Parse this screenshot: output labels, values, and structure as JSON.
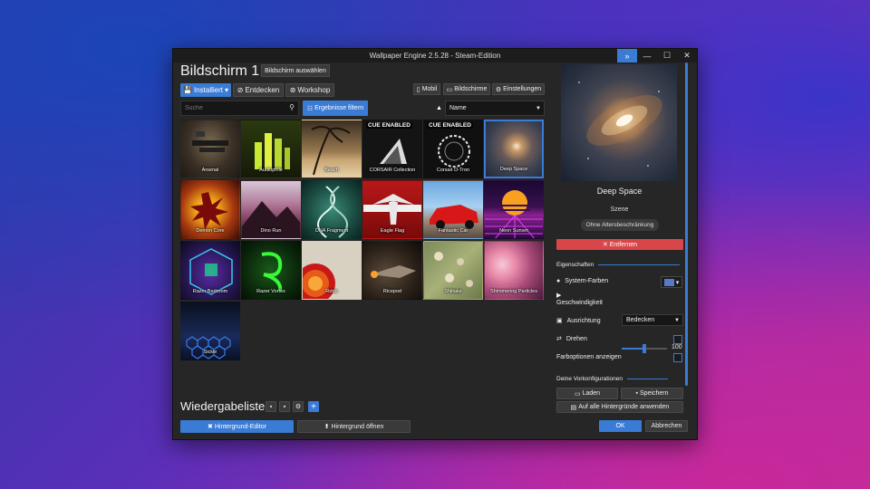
{
  "window": {
    "title": "Wallpaper Engine 2.5.28 - Steam-Edition",
    "controls": [
      "»",
      "—",
      "☐",
      "✕"
    ]
  },
  "header": {
    "title": "Bildschirm 1",
    "select_screen_label": "Bildschirm auswählen"
  },
  "tabs": [
    {
      "label": "Installiert",
      "icon": "save-icon",
      "active": true
    },
    {
      "label": "Entdecken",
      "icon": "compass-icon",
      "active": false
    },
    {
      "label": "Workshop",
      "icon": "steam-icon",
      "active": false
    }
  ],
  "toolbar_right": {
    "mobile_label": "Mobil",
    "screens_label": "Bildschirme",
    "settings_label": "Einstellungen"
  },
  "filter": {
    "search_placeholder": "Suche",
    "filter_label": "Ergebnisse filtern",
    "sort_value": "Name"
  },
  "wallpapers": [
    {
      "label": "Arsenal",
      "cue": false,
      "selected": false
    },
    {
      "label": "Audiophile",
      "cue": false,
      "selected": false
    },
    {
      "label": "Beach",
      "cue": false,
      "selected": false
    },
    {
      "label": "CORSAIR Collection",
      "cue": true,
      "selected": false
    },
    {
      "label": "Corsair D-Tron",
      "cue": true,
      "selected": false
    },
    {
      "label": "Deep Space",
      "cue": false,
      "selected": true
    },
    {
      "label": "Demon Core",
      "cue": false,
      "selected": false
    },
    {
      "label": "Dino Run",
      "cue": false,
      "selected": false
    },
    {
      "label": "DNA Fragment",
      "cue": false,
      "selected": false
    },
    {
      "label": "Eagle Flag",
      "cue": false,
      "selected": false
    },
    {
      "label": "Fantastic Car",
      "cue": false,
      "selected": false
    },
    {
      "label": "Neon Sunset",
      "cue": false,
      "selected": false
    },
    {
      "label": "Razer Bedroom",
      "cue": false,
      "selected": false
    },
    {
      "label": "Razer Vortex",
      "cue": false,
      "selected": false
    },
    {
      "label": "Retro",
      "cue": false,
      "selected": false
    },
    {
      "label": "Ricepod",
      "cue": false,
      "selected": false
    },
    {
      "label": "Shiitake",
      "cue": false,
      "selected": false
    },
    {
      "label": "Shimmering Particles",
      "cue": false,
      "selected": false
    },
    {
      "label": "Sickle",
      "cue": false,
      "selected": false
    }
  ],
  "cue_badge": "CUE ENABLED",
  "playlist": {
    "label": "Wiedergabeliste"
  },
  "bottom": {
    "editor_label": "Hintergrund-Editor",
    "open_label": "Hintergrund öffnen",
    "ok_label": "OK",
    "cancel_label": "Abbrechen"
  },
  "details": {
    "title": "Deep Space",
    "type": "Szene",
    "age_rating": "Ohne Altersbeschränkung",
    "remove_label": "✕ Entfernen"
  },
  "properties": {
    "heading": "Eigenschaften",
    "system_colors_label": "System-Farben",
    "system_color_swatch": "#5a78c8",
    "speed_label": "Geschwindigkeit",
    "speed_value": "100",
    "speed_fraction": 0.5,
    "alignment_label": "Ausrichtung",
    "alignment_value": "Bedecken",
    "rotate_label": "Drehen",
    "color_options_label": "Farboptionen anzeigen"
  },
  "presets": {
    "heading": "Deine Vorkonfigurationen",
    "load_label": "Laden",
    "save_label": "Speichern",
    "apply_all_label": "Auf alle Hintergründe anwenden"
  },
  "colors": {
    "accent": "#3a7bd5",
    "danger": "#d9464a",
    "panel": "#262626"
  }
}
